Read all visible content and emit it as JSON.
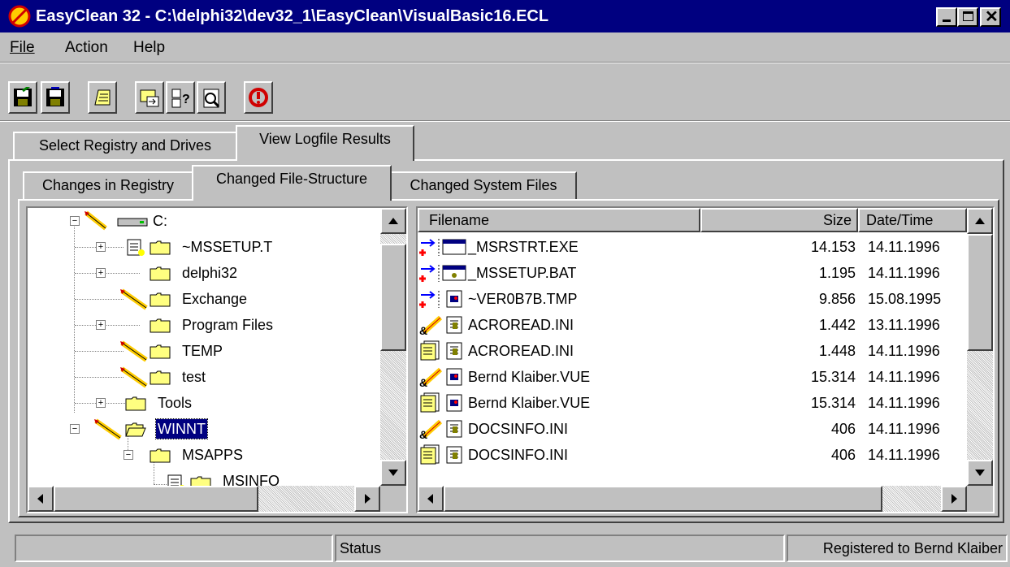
{
  "window": {
    "title": "EasyClean 32 - C:\\delphi32\\dev32_1\\EasyClean\\VisualBasic16.ECL",
    "controls": [
      "minimize",
      "maximize",
      "close"
    ]
  },
  "menu": [
    "File",
    "Action",
    "Help"
  ],
  "toolbar": [
    "save-icon",
    "save-as-icon",
    "open-log-icon",
    "export-icon",
    "registry-help-icon",
    "analyze-icon",
    "stop-icon"
  ],
  "tabs_top": {
    "items": [
      "Select Registry and Drives",
      "View Logfile Results"
    ],
    "active": 1
  },
  "tabs_sub": {
    "items": [
      "Changes in Registry",
      "Changed File-Structure",
      "Changed System Files"
    ],
    "active": 1
  },
  "tree": [
    {
      "label": "C:",
      "level": 0,
      "expand": "minus",
      "icon": "drive",
      "marker": "pencil"
    },
    {
      "label": "~MSSETUP.T",
      "level": 1,
      "expand": "plus",
      "icon": "folder",
      "marker": "doc"
    },
    {
      "label": "delphi32",
      "level": 1,
      "expand": "plus",
      "icon": "folder",
      "marker": "none"
    },
    {
      "label": "Exchange",
      "level": 1,
      "expand": "none",
      "icon": "folder",
      "marker": "pencil"
    },
    {
      "label": "Program Files",
      "level": 1,
      "expand": "plus",
      "icon": "folder",
      "marker": "none"
    },
    {
      "label": "TEMP",
      "level": 1,
      "expand": "none",
      "icon": "folder",
      "marker": "pencil"
    },
    {
      "label": "test",
      "level": 1,
      "expand": "none",
      "icon": "folder",
      "marker": "pencil"
    },
    {
      "label": "Tools",
      "level": 1,
      "expand": "plus",
      "icon": "folder",
      "marker": "none"
    },
    {
      "label": "WINNT",
      "level": 1,
      "expand": "minus",
      "icon": "folder-open",
      "marker": "pencil",
      "selected": true
    },
    {
      "label": "MSAPPS",
      "level": 2,
      "expand": "minus",
      "icon": "folder",
      "marker": "none"
    },
    {
      "label": "MSINFO",
      "level": 3,
      "expand": "none",
      "icon": "folder",
      "marker": "doc"
    }
  ],
  "file_table": {
    "columns": {
      "filename": "Filename",
      "size": "Size",
      "date": "Date/Time"
    },
    "rows": [
      {
        "change": "new",
        "file_icon": "exe-icon",
        "filename": "_MSRSTRT.EXE",
        "size": "14.153",
        "date": "14.11.1996"
      },
      {
        "change": "new",
        "file_icon": "bat-icon",
        "filename": "_MSSETUP.BAT",
        "size": "1.195",
        "date": "14.11.1996"
      },
      {
        "change": "new",
        "file_icon": "image-icon",
        "filename": "~VER0B7B.TMP",
        "size": "9.856",
        "date": "15.08.1995"
      },
      {
        "change": "modified",
        "file_icon": "ini-icon",
        "filename": "ACROREAD.INI",
        "size": "1.442",
        "date": "13.11.1996"
      },
      {
        "change": "copied",
        "file_icon": "ini-icon",
        "filename": "ACROREAD.INI",
        "size": "1.448",
        "date": "14.11.1996"
      },
      {
        "change": "modified",
        "file_icon": "image-icon",
        "filename": "Bernd Klaiber.VUE",
        "size": "15.314",
        "date": "14.11.1996"
      },
      {
        "change": "copied",
        "file_icon": "image-icon",
        "filename": "Bernd Klaiber.VUE",
        "size": "15.314",
        "date": "14.11.1996"
      },
      {
        "change": "modified",
        "file_icon": "ini-icon",
        "filename": "DOCSINFO.INI",
        "size": "406",
        "date": "14.11.1996"
      },
      {
        "change": "copied",
        "file_icon": "ini-icon",
        "filename": "DOCSINFO.INI",
        "size": "406",
        "date": "14.11.1996"
      }
    ]
  },
  "statusbar": {
    "left": "",
    "middle": "Status",
    "right": "Registered to Bernd Klaiber"
  }
}
